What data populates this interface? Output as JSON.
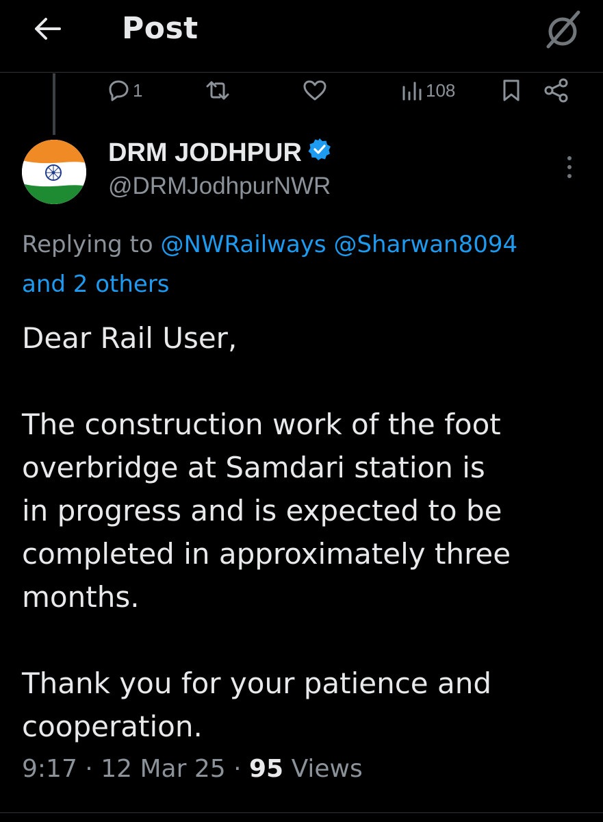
{
  "header": {
    "title": "Post",
    "back_icon": "arrow-left-icon",
    "grok_icon": "grok-icon"
  },
  "actions": {
    "reply_count": "1",
    "repost_count": "",
    "like_count": "",
    "views_count": "108",
    "icons": [
      "reply-icon",
      "repost-icon",
      "like-icon",
      "views-icon",
      "bookmark-icon",
      "share-icon"
    ]
  },
  "author": {
    "display_name": "DRM JODHPUR",
    "handle": "@DRMJodhpurNWR",
    "verified": true
  },
  "replying": {
    "prefix": "Replying to",
    "mention_1": "@NWRailways",
    "mention_2": "@Sharwan8094",
    "others": "and 2 others"
  },
  "tweet": {
    "para1": "Dear Rail User,",
    "para2_lines": [
      "The construction work of the foot",
      "overbridge at Samdari station is",
      "in progress and is expected to be",
      "completed in approximately three",
      "months."
    ],
    "para3_lines": [
      "Thank you for your patience and",
      "cooperation."
    ]
  },
  "meta": {
    "time": "9:17",
    "date": "12 Mar 25",
    "views_number": "95",
    "views_label": "Views",
    "separator": "·"
  },
  "colors": {
    "background": "#000000",
    "text_primary": "#e7e9ea",
    "text_secondary": "#8b9299",
    "link": "#1d9bf0",
    "verified": "#1d9bf0",
    "divider": "#2f3336"
  }
}
